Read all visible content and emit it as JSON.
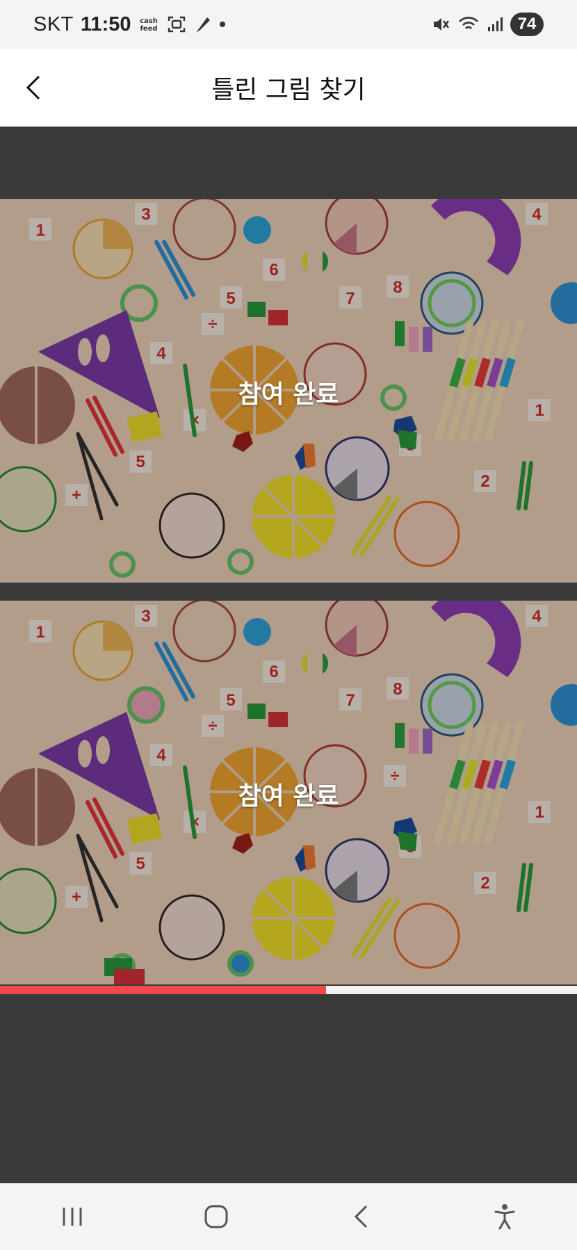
{
  "status_bar": {
    "carrier": "SKT",
    "time": "11:50",
    "cash_icon_text": "cash\nfeed",
    "battery": "74"
  },
  "header": {
    "title": "틀린 그림 찾기"
  },
  "puzzle": {
    "top_overlay_text": "참여 완료",
    "bottom_overlay_text": "참여 완료",
    "progress": 0.565
  },
  "colors": {
    "progress": "#f24a4a",
    "overlay_dim": "#3a3a3a"
  }
}
